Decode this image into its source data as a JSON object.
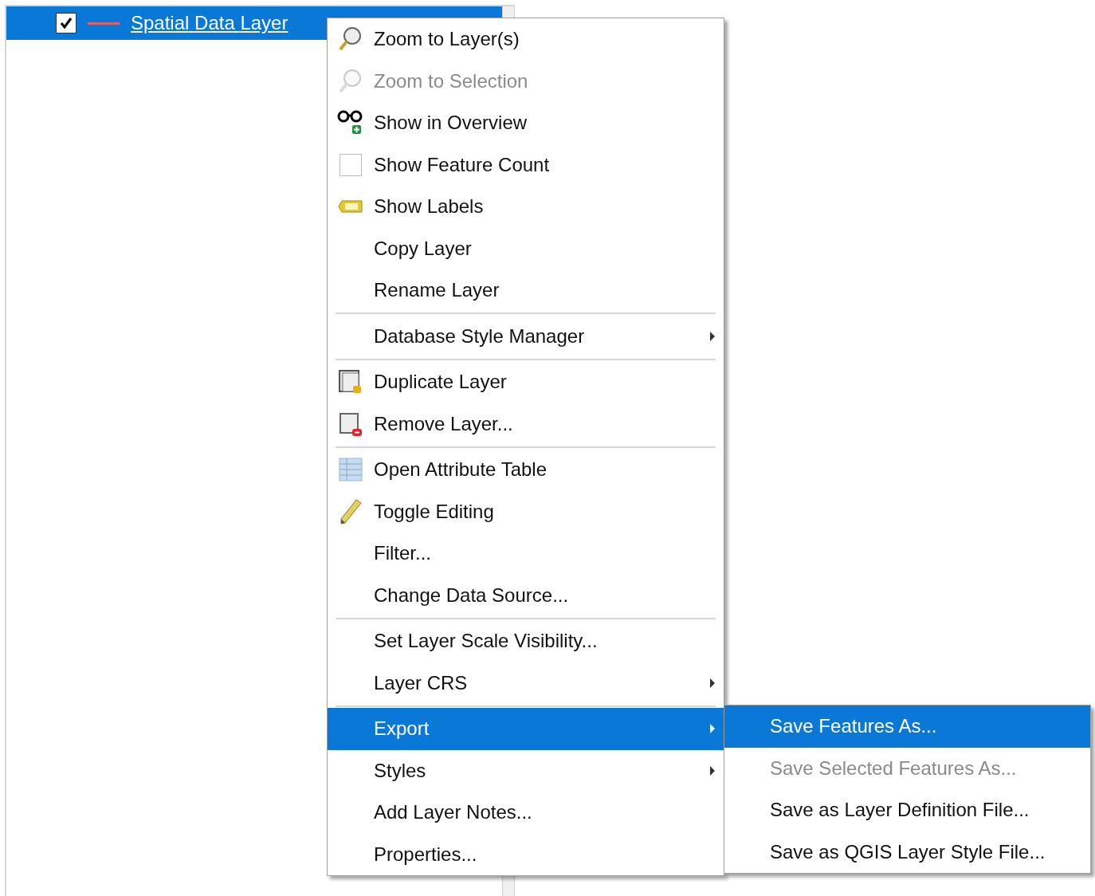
{
  "layers_panel": {
    "layers": [
      {
        "name": "Spatial Data Layer",
        "checked": true,
        "selected": true,
        "color": "#e06070"
      }
    ]
  },
  "context_menu": {
    "items": [
      {
        "kind": "action",
        "label": "Zoom to Layer(s)",
        "disabled": false,
        "selected": false
      },
      {
        "kind": "action",
        "label": "Zoom to Selection",
        "disabled": true,
        "selected": false
      },
      {
        "kind": "action",
        "label": "Show in Overview",
        "disabled": false,
        "selected": false
      },
      {
        "kind": "checkbox",
        "label": "Show Feature Count",
        "checked": false,
        "disabled": false,
        "selected": false
      },
      {
        "kind": "action",
        "label": "Show Labels",
        "disabled": false,
        "selected": false
      },
      {
        "kind": "action",
        "label": "Copy Layer",
        "disabled": false,
        "selected": false
      },
      {
        "kind": "action",
        "label": "Rename Layer",
        "disabled": false,
        "selected": false
      },
      {
        "kind": "separator"
      },
      {
        "kind": "submenu",
        "label": "Database Style Manager",
        "disabled": false,
        "selected": false
      },
      {
        "kind": "separator"
      },
      {
        "kind": "action",
        "label": "Duplicate Layer",
        "disabled": false,
        "selected": false
      },
      {
        "kind": "action",
        "label": "Remove Layer...",
        "disabled": false,
        "selected": false
      },
      {
        "kind": "separator"
      },
      {
        "kind": "action",
        "label": "Open Attribute Table",
        "disabled": false,
        "selected": false
      },
      {
        "kind": "action",
        "label": "Toggle Editing",
        "disabled": false,
        "selected": false
      },
      {
        "kind": "action",
        "label": "Filter...",
        "disabled": false,
        "selected": false
      },
      {
        "kind": "action",
        "label": "Change Data Source...",
        "disabled": false,
        "selected": false
      },
      {
        "kind": "separator"
      },
      {
        "kind": "action",
        "label": "Set Layer Scale Visibility...",
        "disabled": false,
        "selected": false
      },
      {
        "kind": "submenu",
        "label": "Layer CRS",
        "disabled": false,
        "selected": false
      },
      {
        "kind": "separator"
      },
      {
        "kind": "submenu",
        "label": "Export",
        "disabled": false,
        "selected": true
      },
      {
        "kind": "submenu",
        "label": "Styles",
        "disabled": false,
        "selected": false
      },
      {
        "kind": "action",
        "label": "Add Layer Notes...",
        "disabled": false,
        "selected": false
      },
      {
        "kind": "action",
        "label": "Properties...",
        "disabled": false,
        "selected": false
      }
    ]
  },
  "export_submenu": {
    "items": [
      {
        "label": "Save Features As...",
        "disabled": false,
        "selected": true
      },
      {
        "label": "Save Selected Features As...",
        "disabled": true,
        "selected": false
      },
      {
        "label": "Save as Layer Definition File...",
        "disabled": false,
        "selected": false
      },
      {
        "label": "Save as QGIS Layer Style File...",
        "disabled": false,
        "selected": false
      }
    ]
  }
}
